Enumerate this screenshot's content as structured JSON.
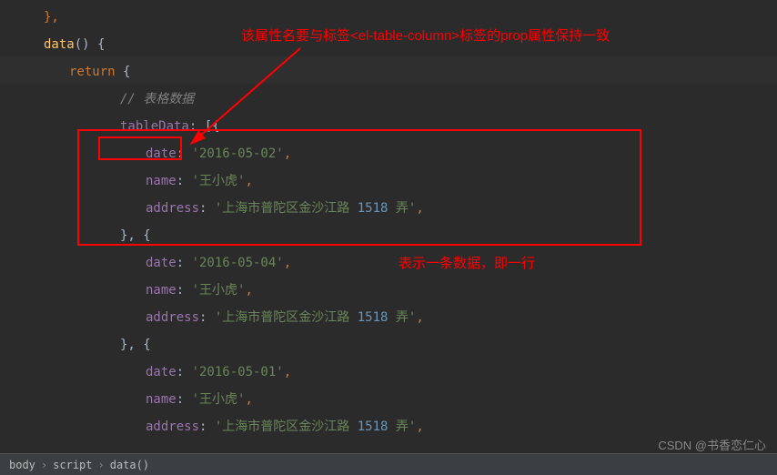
{
  "annotations": {
    "top": "该属性名要与标签<el-table-column>标签的prop属性保持一致",
    "row": "表示一条数据，即一行"
  },
  "code": {
    "l1_close": "},",
    "l2_func": "data",
    "l2_after": "() {",
    "l3_return": "return",
    "l3_brace": " {",
    "l4_comment": "// 表格数据",
    "l5_prop": "tableData",
    "l5_after": ": [{",
    "date_key": "date",
    "name_key": "name",
    "address_key": "address",
    "colon": ": ",
    "comma": ",",
    "obj_sep": "}, {",
    "r1_date": "'2016-05-02'",
    "r1_name": "'王小虎'",
    "r1_addr_p1": "'上海市普陀区金沙江路 ",
    "r1_addr_num": "1518",
    "r1_addr_p2": " 弄'",
    "r2_date": "'2016-05-04'",
    "r2_name": "'王小虎'",
    "r2_addr_p1": "'上海市普陀区金沙江路 ",
    "r2_addr_num": "1518",
    "r2_addr_p2": " 弄'",
    "r3_date": "'2016-05-01'",
    "r3_name": "'王小虎'",
    "r3_addr_p1": "'上海市普陀区金沙江路 ",
    "r3_addr_num": "1518",
    "r3_addr_p2": " 弄'"
  },
  "breadcrumb": {
    "b1": "body",
    "b2": "script",
    "b3": "data()"
  },
  "watermark": "CSDN @书香恋仁心"
}
